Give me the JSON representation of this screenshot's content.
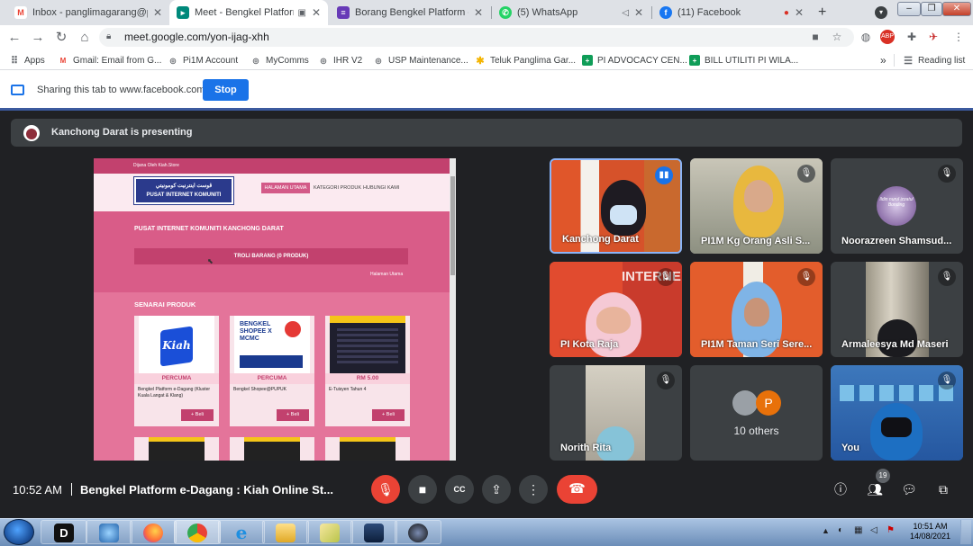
{
  "browser": {
    "tabs": [
      {
        "title": "Inbox - panglimagarang@pi1m",
        "icon": "gmail-icon",
        "color": "#ea4335"
      },
      {
        "title": "Meet - Bengkel Platform e",
        "icon": "meet-icon",
        "color": "#00897b",
        "active": true
      },
      {
        "title": "Borang Bengkel Platform e-Da",
        "icon": "forms-icon",
        "color": "#673ab7"
      },
      {
        "title": "(5) WhatsApp",
        "icon": "whatsapp-icon",
        "color": "#25d366"
      },
      {
        "title": "(11) Facebook",
        "icon": "facebook-icon",
        "color": "#1877f2"
      }
    ],
    "new_tab_label": "+",
    "url": "meet.google.com/yon-ijag-xhh",
    "bookmarks": [
      {
        "label": "Apps",
        "icon": "apps-icon",
        "color": "#5f6368"
      },
      {
        "label": "Gmail: Email from G...",
        "icon": "gmail-icon",
        "color": "#ea4335"
      },
      {
        "label": "Pi1M Account",
        "icon": "globe-icon",
        "color": "#5f6368"
      },
      {
        "label": "MyComms",
        "icon": "globe-icon",
        "color": "#5f6368"
      },
      {
        "label": "IHR V2",
        "icon": "globe-icon",
        "color": "#5f6368"
      },
      {
        "label": "USP Maintenance...",
        "icon": "globe-icon",
        "color": "#5f6368"
      },
      {
        "label": "Teluk Panglima Gar...",
        "icon": "star-icon",
        "color": "#f4b400"
      },
      {
        "label": "PI ADVOCACY CEN...",
        "icon": "sheets-icon",
        "color": "#0f9d58"
      },
      {
        "label": "BILL UTILITI PI WILA...",
        "icon": "sheets-icon",
        "color": "#0f9d58"
      }
    ],
    "more_label": "»",
    "reading_list_label": "Reading list"
  },
  "sharing": {
    "text": "Sharing this tab to www.facebook.com",
    "stop_label": "Stop"
  },
  "presenting": {
    "text": "Kanchong Darat is presenting"
  },
  "shared_page": {
    "top_text": "Dijana Oleh Kiah.Store",
    "logo_line1": "ڤوست اينترنيت كومونيتي",
    "logo_line2": "PUSAT INTERNET KOMUNITI",
    "nav": [
      "HALAMAN UTAMA",
      "KATEGORI PRODUK",
      "HUBUNGI KAMI"
    ],
    "community": "PUSAT INTERNET KOMUNITI KANCHONG DARAT",
    "trolley": "TROLI BARANG (0 PRODUK)",
    "breadcrumb": "Halaman Utama",
    "product_heading": "SENARAI PRODUK",
    "products": [
      {
        "price": "PERCUMA",
        "name": "Bengkel Platform e-Dagang (Kluster Kuala Langat & Klang)",
        "buy": "+ Beli",
        "img_text": "Kiah"
      },
      {
        "price": "PERCUMA",
        "name": "Bengkel Shopee@PUPUK",
        "buy": "+ Beli",
        "img_text": "BENGKEL SHOPEE X MCMC"
      },
      {
        "price": "RM 5.00",
        "name": "E-Tuisyen Tahun 4",
        "buy": "+ Beli",
        "img_text": ""
      }
    ]
  },
  "participants": [
    {
      "name": "Kanchong Darat",
      "speaking": true
    },
    {
      "name": "PI1M Kg Orang Asli S...",
      "muted": true
    },
    {
      "name": "Noorazreen Shamsud...",
      "muted": true,
      "avatar_text": "Ildin nurul izzatul Bonding"
    },
    {
      "name": "PI Kota Raja",
      "muted": true,
      "bg_text": "INTERNE"
    },
    {
      "name": "PI1M Taman Seri Sere...",
      "muted": true
    },
    {
      "name": "Armaleesya Md Maseri",
      "muted": true
    },
    {
      "name": "Norith Rita",
      "muted": true
    },
    {
      "name": "10 others",
      "others_initial": "P"
    },
    {
      "name": "You",
      "muted": true
    }
  ],
  "meeting": {
    "time": "10:52 AM",
    "title": "Bengkel Platform e-Dagang : Kiah Online St...",
    "participant_count": "19"
  },
  "taskbar": {
    "clock_time": "10:51 AM",
    "clock_date": "14/08/2021"
  }
}
